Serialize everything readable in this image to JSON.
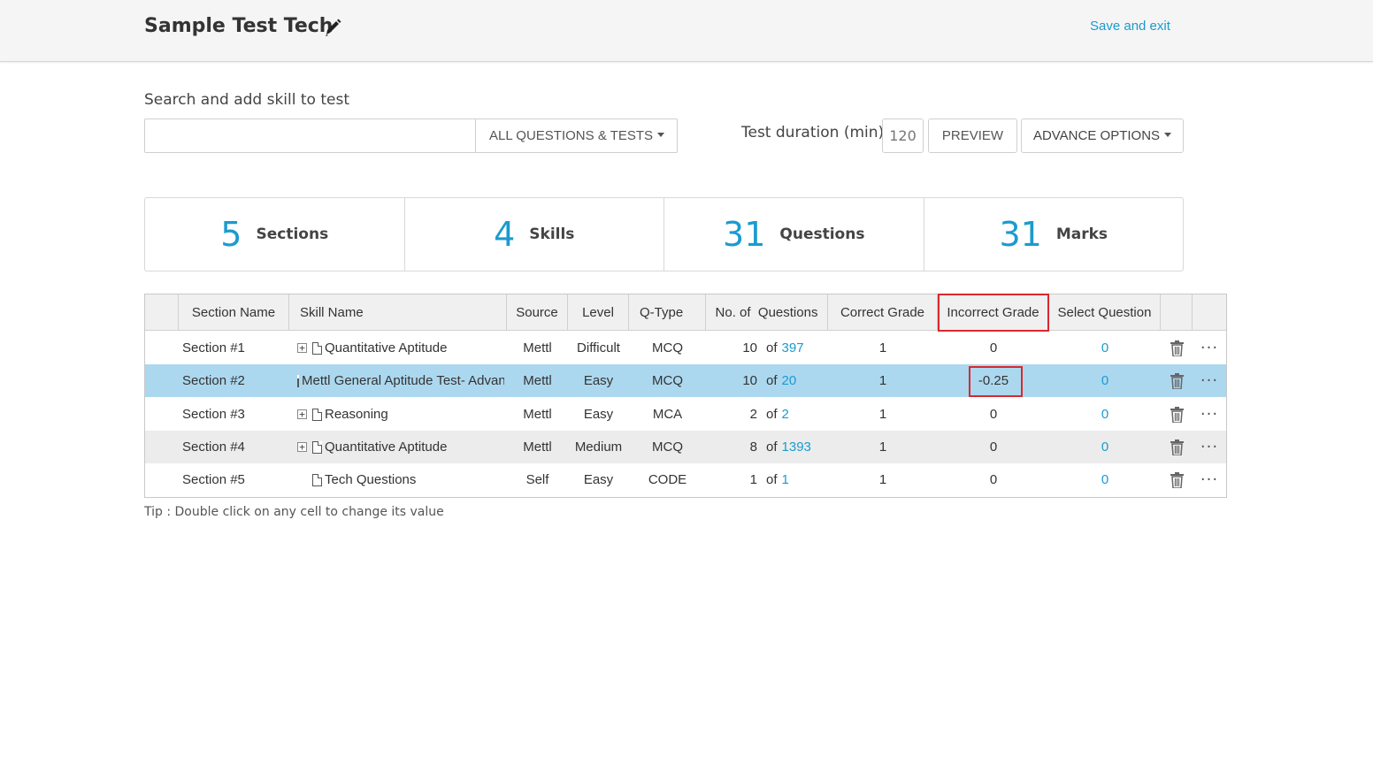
{
  "header": {
    "title": "Sample Test Tech",
    "edit_icon": "pencil-icon",
    "save_exit": "Save and exit"
  },
  "search": {
    "label": "Search and add skill to test",
    "value": "",
    "filter_label": "ALL QUESTIONS & TESTS"
  },
  "duration": {
    "label": "Test duration (min)",
    "value": "120"
  },
  "buttons": {
    "preview": "PREVIEW",
    "advance": "ADVANCE OPTIONS"
  },
  "stats": [
    {
      "value": "5",
      "label": "Sections"
    },
    {
      "value": "4",
      "label": "Skills"
    },
    {
      "value": "31",
      "label": "Questions"
    },
    {
      "value": "31",
      "label": "Marks"
    }
  ],
  "table": {
    "columns": [
      "Section Name",
      "Skill Name",
      "Source",
      "Level",
      "Q-Type",
      "No. of  Questions",
      "Correct Grade",
      "Incorrect Grade",
      "Select Question"
    ],
    "rows": [
      {
        "section": "Section #1",
        "skill": "Quantitative Aptitude",
        "expandable": true,
        "source": "Mettl",
        "level": "Difficult",
        "qtype": "MCQ",
        "count": "10",
        "of": "of",
        "total": "397",
        "correct": "1",
        "incorrect": "0",
        "select": "0"
      },
      {
        "section": "Section #2",
        "skill": "Mettl General Aptitude Test- Advanced",
        "expandable": false,
        "source": "Mettl",
        "level": "Easy",
        "qtype": "MCQ",
        "count": "10",
        "of": "of",
        "total": "20",
        "correct": "1",
        "incorrect": "-0.25",
        "select": "0"
      },
      {
        "section": "Section #3",
        "skill": "Reasoning",
        "expandable": true,
        "source": "Mettl",
        "level": "Easy",
        "qtype": "MCA",
        "count": "2",
        "of": "of",
        "total": "2",
        "correct": "1",
        "incorrect": "0",
        "select": "0"
      },
      {
        "section": "Section #4",
        "skill": "Quantitative Aptitude",
        "expandable": true,
        "source": "Mettl",
        "level": "Medium",
        "qtype": "MCQ",
        "count": "8",
        "of": "of",
        "total": "1393",
        "correct": "1",
        "incorrect": "0",
        "select": "0"
      },
      {
        "section": "Section #5",
        "skill": "Tech Questions",
        "expandable": false,
        "source": "Self",
        "level": "Easy",
        "qtype": "CODE",
        "count": "1",
        "of": "of",
        "total": "1",
        "correct": "1",
        "incorrect": "0",
        "select": "0"
      }
    ],
    "selected_row": 1
  },
  "tip": "Tip : Double click on any cell to change its value",
  "colors": {
    "accent": "#1a9bcf",
    "selected_row": "#acd8ef",
    "highlight": "#d9282f"
  }
}
